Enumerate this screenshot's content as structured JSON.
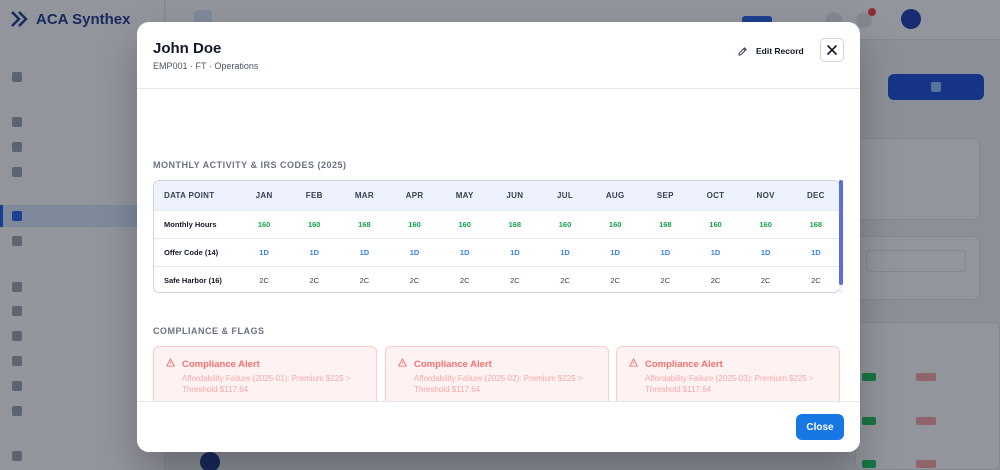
{
  "app": {
    "name": "ACA Synthex"
  },
  "topbar": {
    "company_name": "",
    "user_name": ""
  },
  "modal": {
    "title": "John Doe",
    "subtitle": "EMP001 · FT · Operations",
    "edit_label": "Edit Record",
    "close_label": "Close",
    "activity_section_title": "MONTHLY ACTIVITY & IRS CODES (2025)",
    "compliance_section_title": "COMPLIANCE & FLAGS",
    "table": {
      "columns": [
        "DATA POINT",
        "JAN",
        "FEB",
        "MAR",
        "APR",
        "MAY",
        "JUN",
        "JUL",
        "AUG",
        "SEP",
        "OCT",
        "NOV",
        "DEC"
      ],
      "rows": [
        {
          "label": "Monthly Hours",
          "kind": "hours",
          "values": [
            "160",
            "160",
            "168",
            "160",
            "160",
            "168",
            "160",
            "160",
            "168",
            "160",
            "160",
            "168"
          ]
        },
        {
          "label": "Offer Code (14)",
          "kind": "offer",
          "values": [
            "1D",
            "1D",
            "1D",
            "1D",
            "1D",
            "1D",
            "1D",
            "1D",
            "1D",
            "1D",
            "1D",
            "1D"
          ]
        },
        {
          "label": "Safe Harbor (16)",
          "kind": "harbor",
          "values": [
            "2C",
            "2C",
            "2C",
            "2C",
            "2C",
            "2C",
            "2C",
            "2C",
            "2C",
            "2C",
            "2C",
            "2C"
          ]
        }
      ]
    },
    "alerts": [
      {
        "title": "Compliance Alert",
        "desc": "Affordability Failure (2025-01): Premium $225 > Threshold $117.64"
      },
      {
        "title": "Compliance Alert",
        "desc": "Affordability Failure (2025-02): Premium $225 > Threshold $117.64"
      },
      {
        "title": "Compliance Alert",
        "desc": "Affordability Failure (2025-03): Premium $225 > Threshold $117.64"
      }
    ]
  },
  "colors": {
    "primary": "#1677e5",
    "hours": "#16a34a",
    "offer": "#3b82f6",
    "alert_bg": "#fef2f2",
    "alert_text": "#f87171"
  }
}
